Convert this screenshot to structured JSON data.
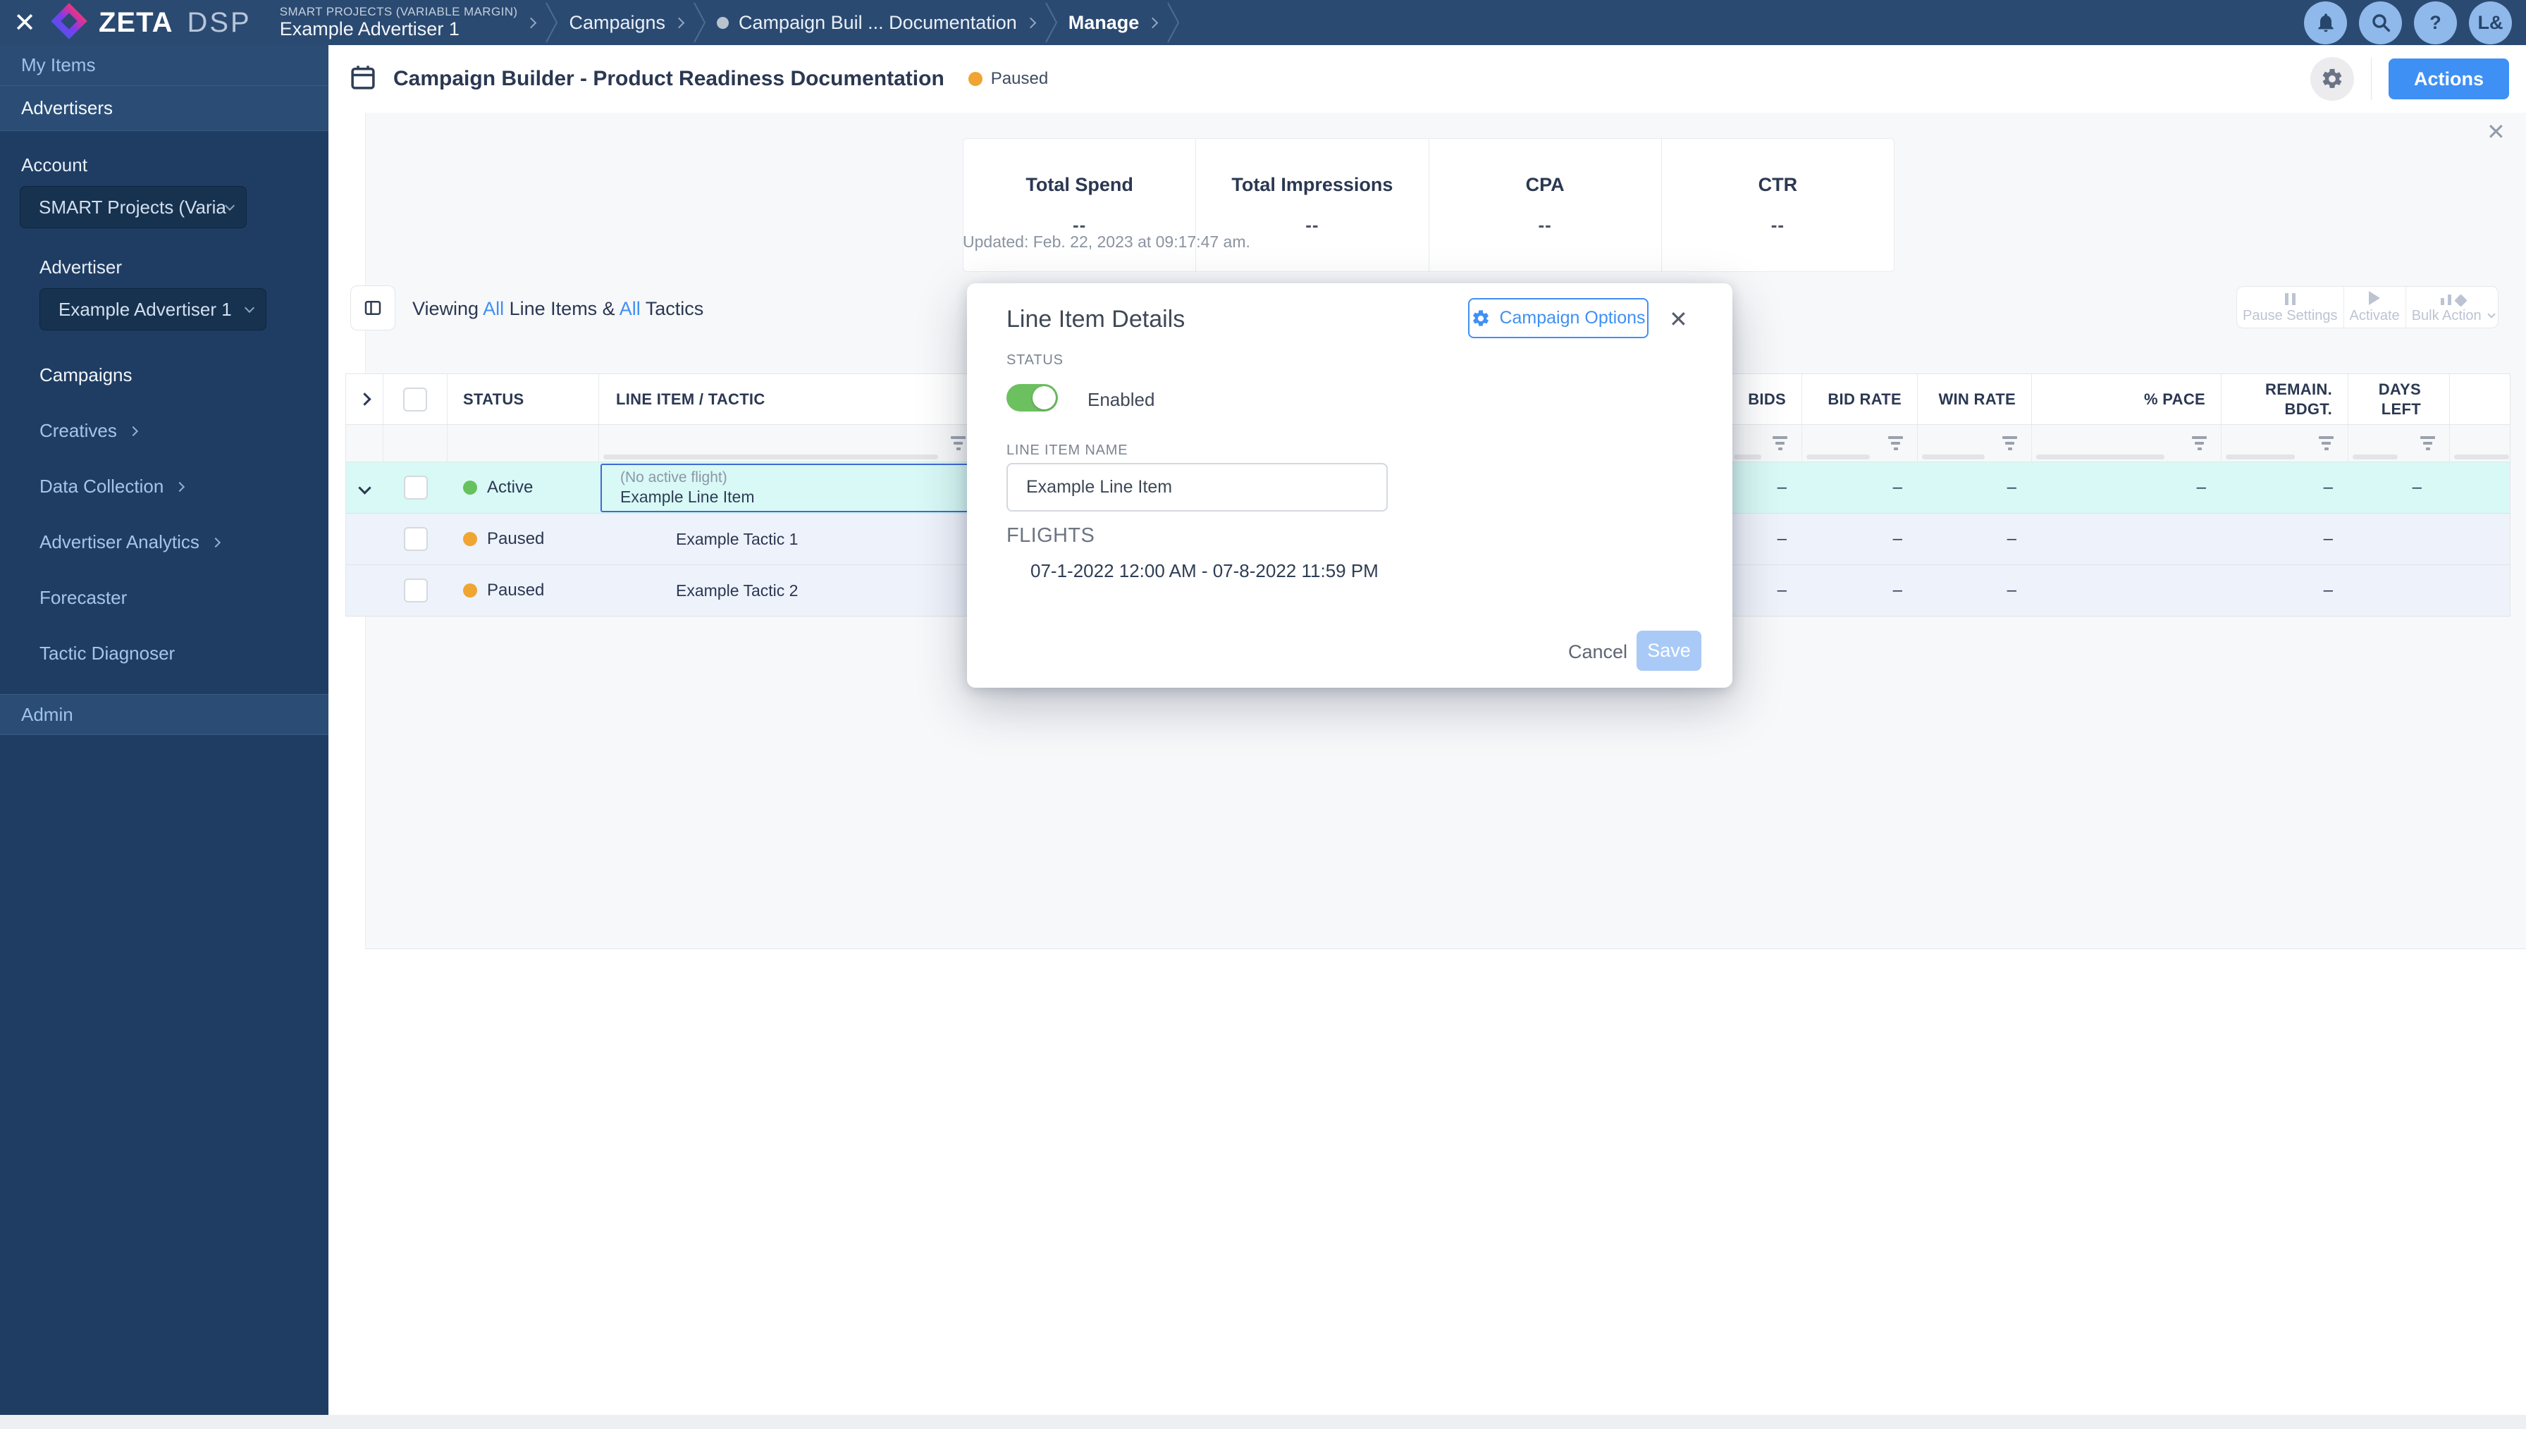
{
  "colors": {
    "accent": "#3f90f4",
    "active_green": "#67c15e",
    "paused_orange": "#f0a432",
    "toggle_green": "#6cc05f",
    "row_highlight": "#d8f9f6"
  },
  "topbar": {
    "logo_zeta": "ZETA",
    "logo_dsp": "DSP",
    "breadcrumbs": {
      "crumb1_eyebrow": "SMART PROJECTS (VARIABLE MARGIN)",
      "crumb1_label": "Example Advertiser 1",
      "crumb2_label": "Campaigns",
      "crumb3_label": "Campaign Buil ... Documentation",
      "crumb4_label": "Manage"
    },
    "help_glyph": "?",
    "avatar_initials": "L&"
  },
  "sidebar": {
    "my_items": "My Items",
    "advertisers": "Advertisers",
    "account_label": "Account",
    "account_value": "SMART Projects (Variable M...",
    "advertiser_label": "Advertiser",
    "advertiser_value": "Example Advertiser 1",
    "links": [
      {
        "label": "Campaigns"
      },
      {
        "label": "Creatives"
      },
      {
        "label": "Data Collection"
      },
      {
        "label": "Advertiser Analytics"
      },
      {
        "label": "Forecaster"
      },
      {
        "label": "Tactic Diagnoser"
      }
    ],
    "admin": "Admin"
  },
  "header": {
    "title": "Campaign Builder - Product Readiness Documentation",
    "status": "Paused",
    "actions": "Actions"
  },
  "stats": {
    "cards": [
      {
        "label": "Total Spend",
        "value": "--"
      },
      {
        "label": "Total Impressions",
        "value": "--"
      },
      {
        "label": "CPA",
        "value": "--"
      },
      {
        "label": "CTR",
        "value": "--"
      }
    ],
    "updated": "Updated: Feb. 22, 2023 at 09:17:47 am."
  },
  "toolbar": {
    "viewing_1": "Viewing",
    "viewing_all_1": "All",
    "viewing_2": "Line Items &",
    "viewing_all_2": "All",
    "viewing_3": "Tactics",
    "pause_settings": "Pause Settings",
    "activate": "Activate",
    "bulk_action": "Bulk Action"
  },
  "table": {
    "headers": {
      "status": "STATUS",
      "line_item": "LINE ITEM / TACTIC",
      "bids": "BIDS",
      "bid_rate": "BID RATE",
      "win_rate": "WIN RATE",
      "pace": "% PACE",
      "remain_line1": "REMAIN.",
      "remain_line2": "BDGT.",
      "days_line1": "DAYS",
      "days_line2": "LEFT"
    },
    "rows": [
      {
        "status": "Active",
        "flight_note": "(No active flight)",
        "name": "Example Line Item",
        "bids": "–",
        "bid_rate": "–",
        "win_rate": "–",
        "pace": "–",
        "remain": "–",
        "days": "–"
      },
      {
        "status": "Paused",
        "name": "Example Tactic 1",
        "bids": "–",
        "bid_rate": "–",
        "win_rate": "–",
        "remain": "–"
      },
      {
        "status": "Paused",
        "name": "Example Tactic 2",
        "bids": "–",
        "bid_rate": "–",
        "win_rate": "–",
        "remain": "–"
      }
    ]
  },
  "modal": {
    "title": "Line Item Details",
    "campaign_options": "Campaign Options",
    "status_label": "STATUS",
    "status_value": "Enabled",
    "name_label": "LINE ITEM NAME",
    "name_value": "Example Line Item",
    "flights_label": "FLIGHTS",
    "flight_range": "07-1-2022 12:00 AM - 07-8-2022 11:59 PM",
    "cancel": "Cancel",
    "save": "Save"
  }
}
